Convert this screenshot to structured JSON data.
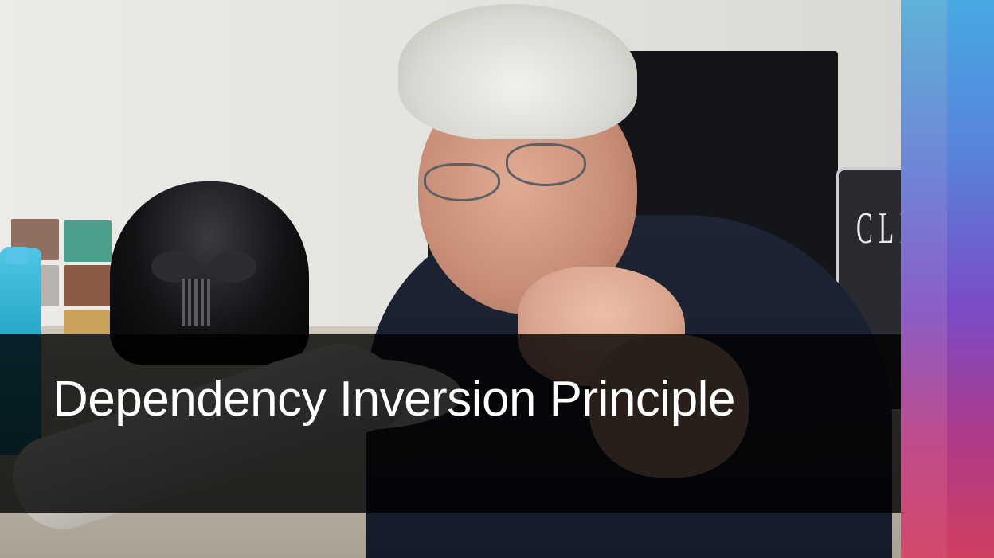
{
  "title": {
    "text": "Dependency Inversion Principle"
  },
  "background_elements": {
    "laptop_screen_text": "CLEAN C"
  },
  "colors": {
    "band": "#000000",
    "title": "#ffffff",
    "strip_top": "#4aaee0",
    "strip_bottom": "#cf3f5f"
  }
}
